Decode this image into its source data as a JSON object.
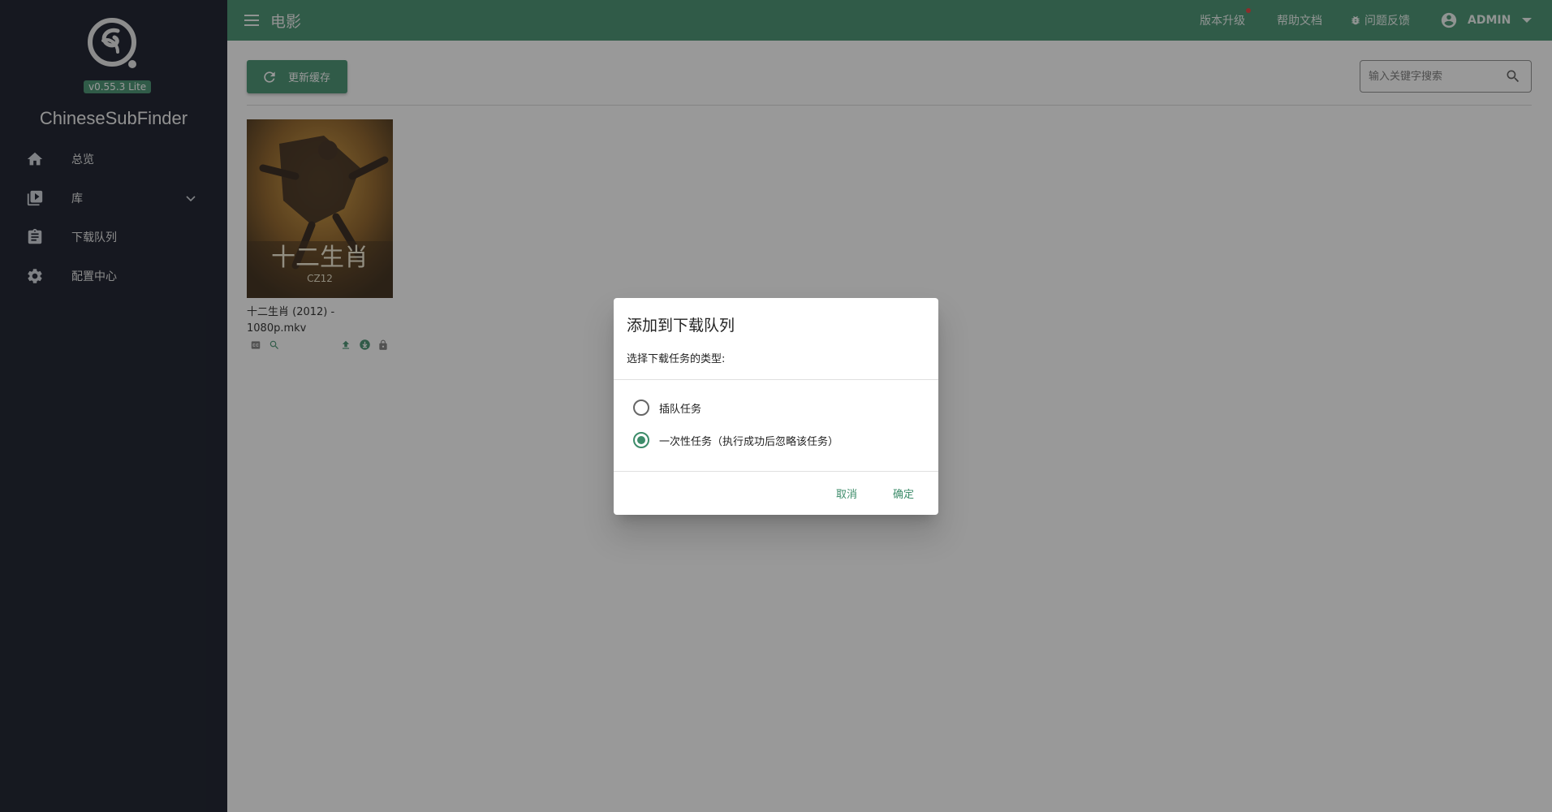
{
  "colors": {
    "sidebar_bg": "#0d1220",
    "accent": "#3d8c6a",
    "overlay": "rgba(33,33,33,0.46)"
  },
  "sidebar": {
    "version": "v0.55.3 Lite",
    "app_name": "ChineseSubFinder",
    "items": [
      {
        "label": "总览",
        "icon": "home-icon"
      },
      {
        "label": "库",
        "icon": "video-library-icon",
        "expandable": true
      },
      {
        "label": "下载队列",
        "icon": "clipboard-icon"
      },
      {
        "label": "配置中心",
        "icon": "gear-icon"
      }
    ]
  },
  "topbar": {
    "title": "电影",
    "links": {
      "upgrade": "版本升级",
      "docs": "帮助文档",
      "feedback": "问题反馈"
    },
    "user": "ADMIN"
  },
  "main": {
    "refresh_label": "更新缓存",
    "search": {
      "placeholder": "输入关键字搜索",
      "value": ""
    },
    "movies": [
      {
        "title": "十二生肖 (2012) - 1080p.mkv",
        "poster_text": "十二生肖",
        "poster_logo": "CZ12",
        "icons": [
          "subtitle-icon",
          "search-icon",
          "upload-icon",
          "download-icon",
          "lock-icon"
        ]
      }
    ]
  },
  "dialog": {
    "title": "添加到下载队列",
    "subtitle": "选择下载任务的类型:",
    "options": [
      {
        "label": "插队任务",
        "checked": false
      },
      {
        "label": "一次性任务（执行成功后忽略该任务）",
        "checked": true
      }
    ],
    "cancel": "取消",
    "confirm": "确定"
  }
}
